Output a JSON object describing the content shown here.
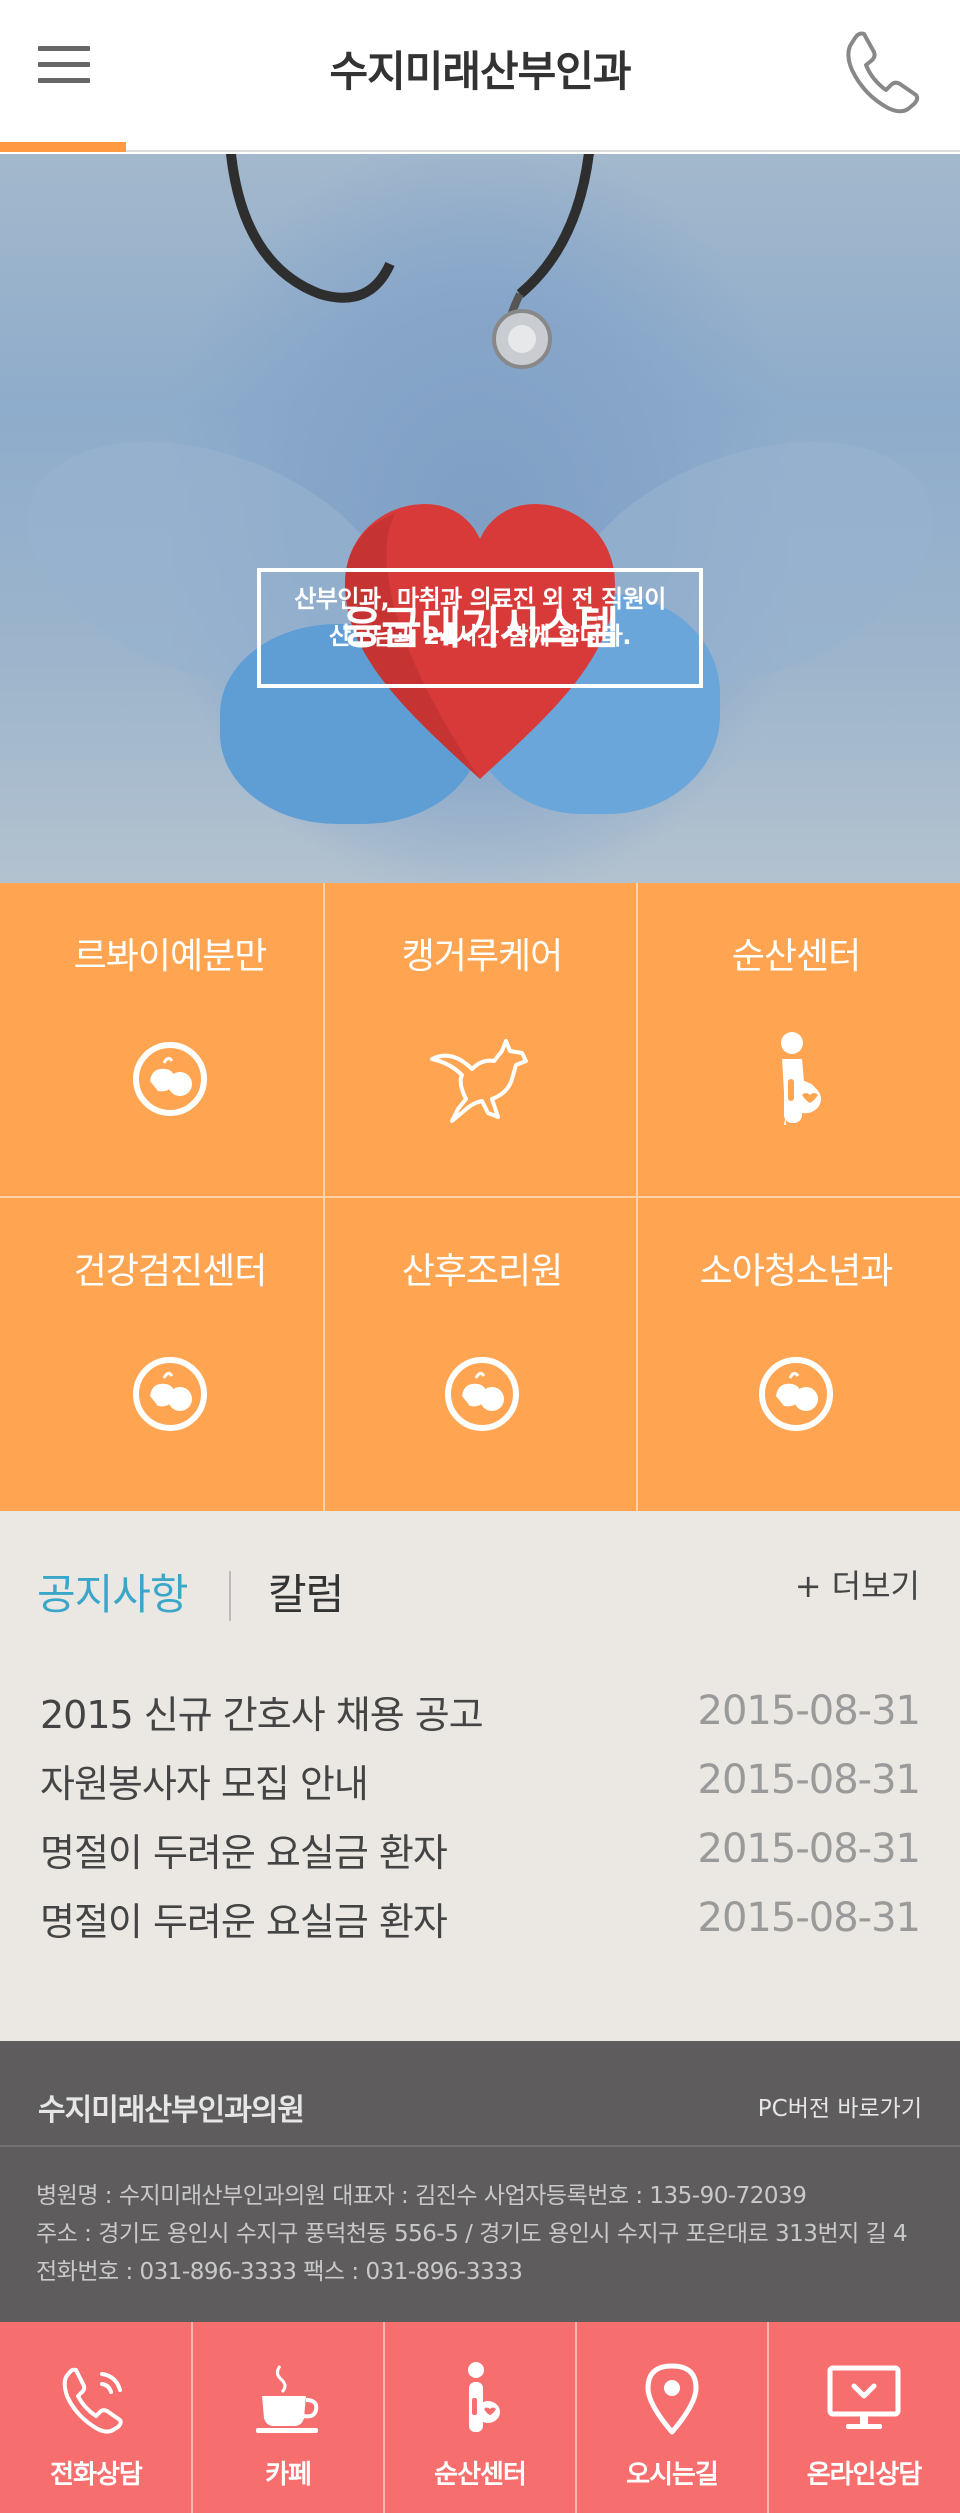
{
  "header": {
    "title": "수지미래산부인과",
    "menu_icon": "hamburger-menu-icon",
    "phone_icon": "phone-icon",
    "accent_color": "#ff9a42"
  },
  "hero": {
    "title": "응급대기시스템",
    "line1": "산부인과, 마취과 의료진 외 전 직원이",
    "line2": "산모님과 24시간 함께 합니다.",
    "slides_total": 3,
    "active_slide": 1,
    "dot_active_color": "#f26d5a"
  },
  "services": {
    "background": "#ffa552",
    "items": [
      {
        "label": "르봐이예분만",
        "icon": "baby-circle-icon"
      },
      {
        "label": "캥거루케어",
        "icon": "kangaroo-icon"
      },
      {
        "label": "순산센터",
        "icon": "pregnant-woman-icon"
      },
      {
        "label": "건강검진센터",
        "icon": "baby-circle-icon"
      },
      {
        "label": "산후조리원",
        "icon": "baby-circle-icon"
      },
      {
        "label": "소아청소년과",
        "icon": "baby-circle-icon"
      }
    ]
  },
  "notice": {
    "tab_active": "공지사항",
    "tab_other": "칼럼",
    "more": "+ 더보기",
    "active_color": "#3aa7c8",
    "rows": [
      {
        "title": "2015 신규 간호사 채용 공고",
        "date": "2015-08-31"
      },
      {
        "title": "자원봉사자 모집 안내",
        "date": "2015-08-31"
      },
      {
        "title": "명절이 두려운 요실금 환자",
        "date": "2015-08-31"
      },
      {
        "title": "명절이 두려운 요실금 환자",
        "date": "2015-08-31"
      }
    ]
  },
  "footer": {
    "name": "수지미래산부인과의원",
    "pc_link": "PC버전 바로가기",
    "info1": "병원명 : 수지미래산부인과의원     대표자 : 김진수     사업자등록번호 : 135-90-72039",
    "info2": "주소 : 경기도 용인시 수지구 풍덕천동 556-5 / 경기도 용인시 수지구 포은대로 313번지 길 4",
    "info3": "전화번호 : 031-896-3333     팩스 :  031-896-3333"
  },
  "bottom_nav": {
    "background": "#f76e6e",
    "items": [
      {
        "label": "전화상담",
        "icon": "phone-call-icon"
      },
      {
        "label": "카페",
        "icon": "coffee-cup-icon"
      },
      {
        "label": "순산센터",
        "icon": "pregnant-woman-icon"
      },
      {
        "label": "오시는길",
        "icon": "map-pin-icon"
      },
      {
        "label": "온라인상담",
        "icon": "monitor-icon"
      }
    ]
  }
}
